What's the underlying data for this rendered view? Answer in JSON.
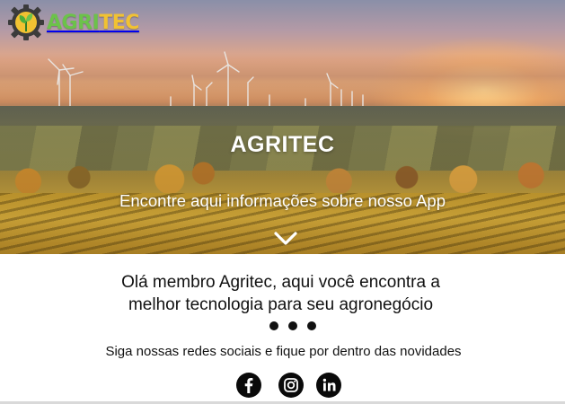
{
  "brand": {
    "part_a": "AGRI",
    "part_b": "TEC",
    "color_a": "#6cc24a",
    "color_b": "#f1c232",
    "icon": "gear-leaf-logo-icon"
  },
  "hero": {
    "title": "AGRITEC",
    "subtitle": "Encontre aqui informações sobre nosso App",
    "scroll_icon": "chevron-down-icon"
  },
  "welcome": {
    "line1": "Olá membro Agritec, aqui você encontra a",
    "line2": "melhor tecnologia para seu agronegócio"
  },
  "carousel": {
    "dots": [
      "dot-1",
      "dot-2",
      "dot-3"
    ]
  },
  "social": {
    "caption": "Siga nossas redes sociais e fique por dentro das novidades",
    "links": [
      {
        "name": "facebook-icon"
      },
      {
        "name": "instagram-icon"
      },
      {
        "name": "linkedin-icon"
      }
    ]
  }
}
